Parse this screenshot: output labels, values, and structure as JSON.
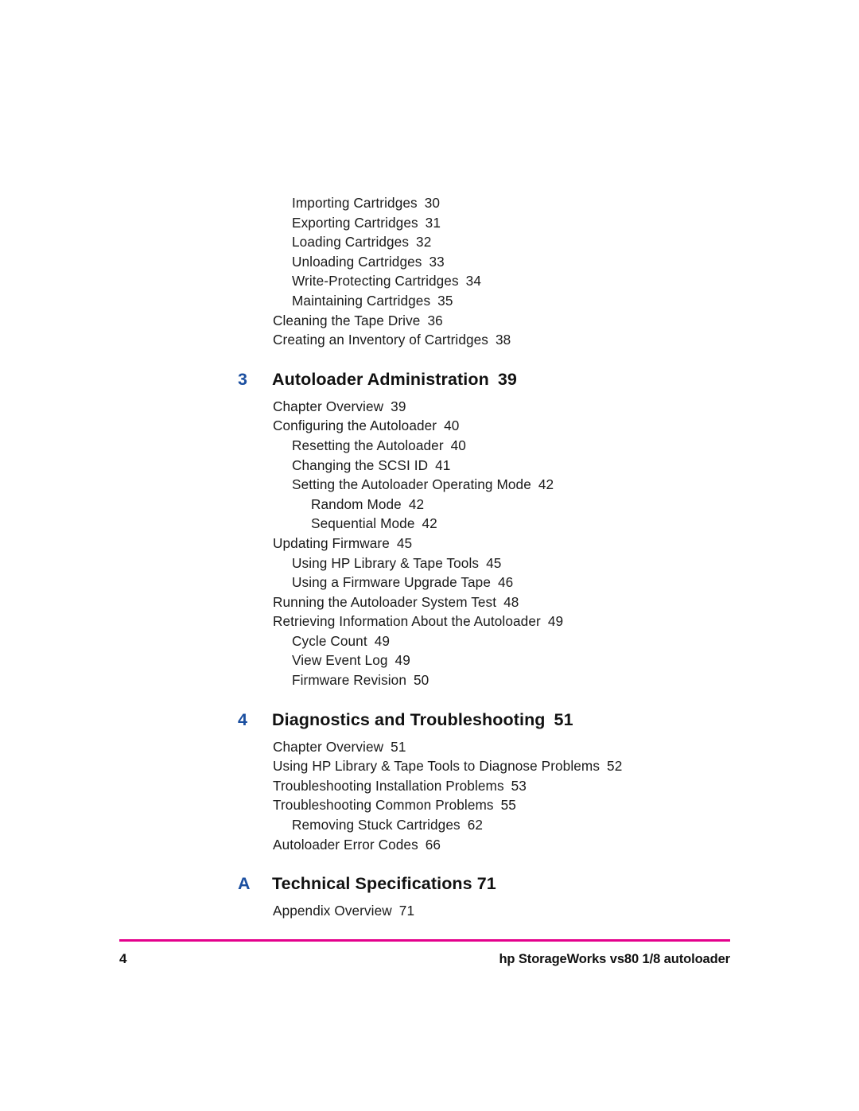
{
  "document": {
    "type": "table-of-contents",
    "accent_blue": "#1B4FA0",
    "rule_magenta": "#E4008C"
  },
  "toc": {
    "continued_entries": [
      {
        "level": 2,
        "label": "Importing Cartridges",
        "page": "30"
      },
      {
        "level": 2,
        "label": "Exporting Cartridges",
        "page": "31"
      },
      {
        "level": 2,
        "label": "Loading Cartridges",
        "page": "32"
      },
      {
        "level": 2,
        "label": "Unloading Cartridges",
        "page": "33"
      },
      {
        "level": 2,
        "label": "Write-Protecting Cartridges",
        "page": "34"
      },
      {
        "level": 2,
        "label": "Maintaining Cartridges",
        "page": "35"
      },
      {
        "level": 1,
        "label": "Cleaning the Tape Drive",
        "page": "36"
      },
      {
        "level": 1,
        "label": "Creating an Inventory of Cartridges",
        "page": "38"
      }
    ],
    "chapters": [
      {
        "number": "3",
        "title": "Autoloader Administration",
        "page": "39",
        "tight": false,
        "entries": [
          {
            "level": 1,
            "label": "Chapter Overview",
            "page": "39"
          },
          {
            "level": 1,
            "label": "Configuring the Autoloader",
            "page": "40"
          },
          {
            "level": 2,
            "label": "Resetting the Autoloader",
            "page": "40"
          },
          {
            "level": 2,
            "label": "Changing the SCSI ID",
            "page": "41"
          },
          {
            "level": 2,
            "label": "Setting the Autoloader Operating Mode",
            "page": "42"
          },
          {
            "level": 3,
            "label": "Random Mode",
            "page": "42"
          },
          {
            "level": 3,
            "label": "Sequential Mode",
            "page": "42"
          },
          {
            "level": 1,
            "label": "Updating Firmware",
            "page": "45"
          },
          {
            "level": 2,
            "label": "Using HP Library & Tape Tools",
            "page": "45"
          },
          {
            "level": 2,
            "label": "Using a Firmware Upgrade Tape",
            "page": "46"
          },
          {
            "level": 1,
            "label": "Running the Autoloader System Test",
            "page": "48"
          },
          {
            "level": 1,
            "label": "Retrieving Information About the Autoloader",
            "page": "49"
          },
          {
            "level": 2,
            "label": "Cycle Count",
            "page": "49"
          },
          {
            "level": 2,
            "label": "View Event Log",
            "page": "49"
          },
          {
            "level": 2,
            "label": "Firmware Revision",
            "page": "50"
          }
        ]
      },
      {
        "number": "4",
        "title": "Diagnostics and Troubleshooting",
        "page": "51",
        "tight": false,
        "entries": [
          {
            "level": 1,
            "label": "Chapter Overview",
            "page": "51"
          },
          {
            "level": 1,
            "label": "Using HP Library & Tape Tools to Diagnose Problems",
            "page": "52"
          },
          {
            "level": 1,
            "label": "Troubleshooting Installation Problems",
            "page": "53"
          },
          {
            "level": 1,
            "label": "Troubleshooting Common Problems",
            "page": "55"
          },
          {
            "level": 2,
            "label": "Removing Stuck Cartridges",
            "page": "62"
          },
          {
            "level": 1,
            "label": "Autoloader Error Codes",
            "page": "66"
          }
        ]
      },
      {
        "number": "A",
        "title": "Technical Specifications",
        "page": "71",
        "tight": true,
        "entries": [
          {
            "level": 1,
            "label": "Appendix Overview",
            "page": "71"
          }
        ]
      }
    ]
  },
  "footer": {
    "page_number": "4",
    "product_title": "hp StorageWorks vs80 1/8 autoloader"
  }
}
